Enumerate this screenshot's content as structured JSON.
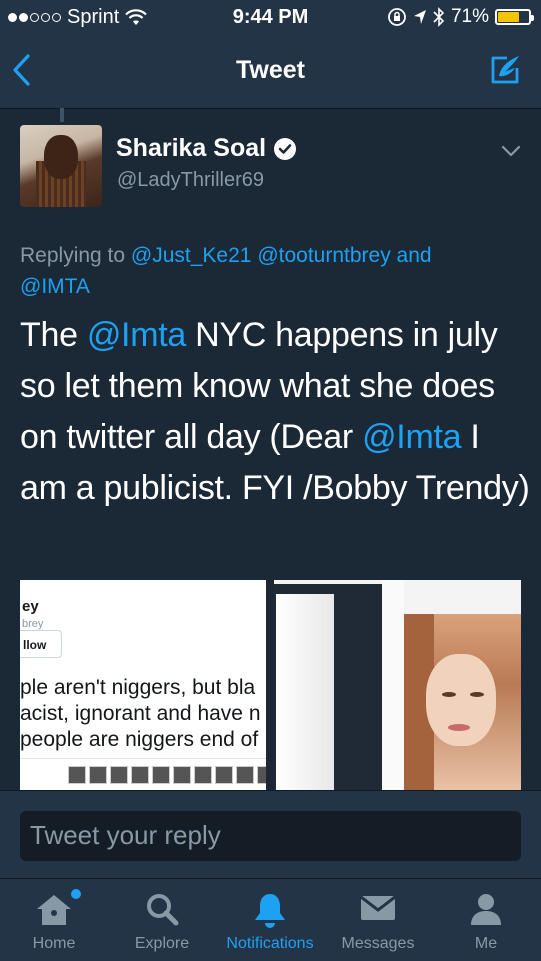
{
  "status_bar": {
    "carrier": "Sprint",
    "time": "9:44 PM",
    "battery": "71%",
    "battery_level": 0.71
  },
  "nav": {
    "title": "Tweet",
    "back_icon": "chevron-left-icon",
    "compose_icon": "compose-tweet-icon"
  },
  "tweet": {
    "display_name": "Sharika Soal",
    "handle": "@LadyThriller69",
    "replying_prefix": "Replying to",
    "reply_to_1": "@Just_Ke21",
    "reply_to_2": "@tooturntbrey",
    "reply_and": "and",
    "reply_to_3": "@IMTA",
    "text_1": "The",
    "mention_1": "@Imta",
    "text_2": " NYC happens in july so  let them know what she does on twitter all day  (Dear",
    "mention_2": "@Imta",
    "text_3": " I am a publicist. FYI /Bobby Trendy)"
  },
  "media": {
    "image_1": {
      "name_fragment": "ey",
      "handle_fragment": "brey",
      "button": "llow",
      "line_1": "ple aren't niggers, but bla",
      "line_2": "acist, ignorant and have n",
      "line_3": "people are niggers end of"
    }
  },
  "composer": {
    "placeholder": "Tweet your reply"
  },
  "tabs": [
    {
      "label": "Home",
      "icon": "home-icon"
    },
    {
      "label": "Explore",
      "icon": "search-icon"
    },
    {
      "label": "Notifications",
      "icon": "bell-icon"
    },
    {
      "label": "Messages",
      "icon": "envelope-icon"
    },
    {
      "label": "Me",
      "icon": "person-icon"
    }
  ],
  "colors": {
    "background": "#1b2836",
    "bar": "#243447",
    "accent": "#1da1f2",
    "muted": "#8899a6"
  }
}
